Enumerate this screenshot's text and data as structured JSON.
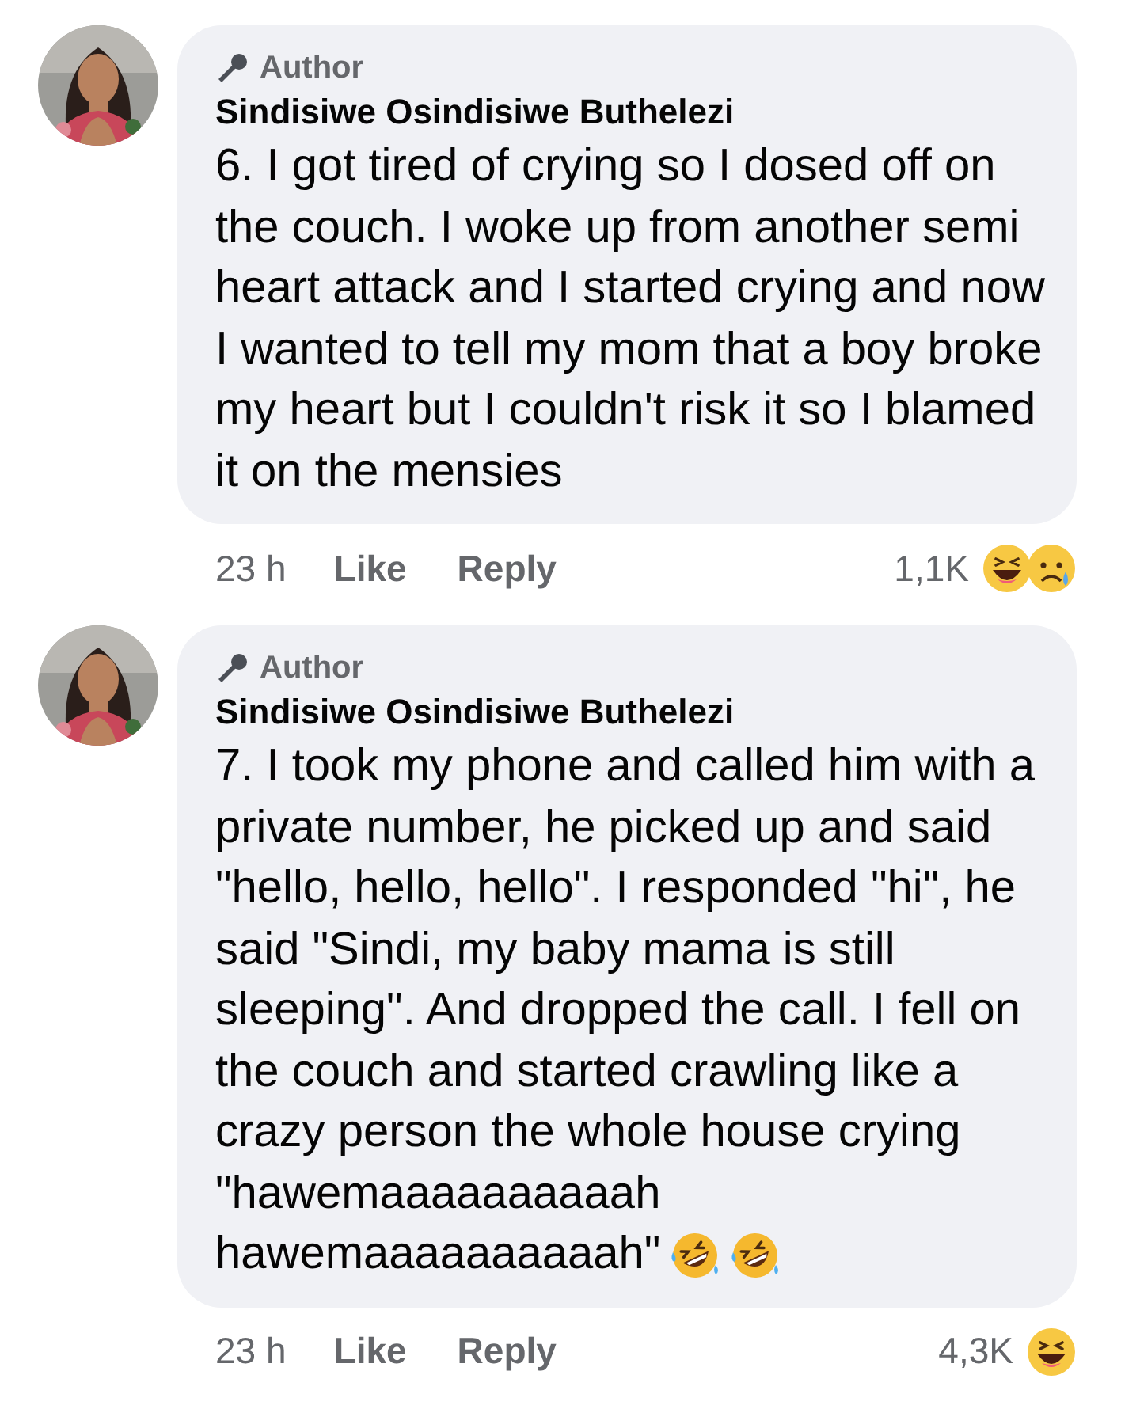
{
  "comments": [
    {
      "badge": "Author",
      "name": "Sindisiwe Osindisiwe Buthelezi",
      "body": "6. I got tired of crying so I dosed off on the couch. I woke up from another semi heart attack and I started crying and now I wanted to tell my mom that a boy broke my heart but I couldn't risk it so I blamed it on the mensies",
      "time": "23 h",
      "actions": [
        "Like",
        "Reply"
      ],
      "reaction_count": "1,1K",
      "reactions": [
        {
          "kind": "laugh"
        },
        {
          "kind": "sad"
        }
      ]
    },
    {
      "badge": "Author",
      "name": "Sindisiwe Osindisiwe Buthelezi",
      "body": "7. I took my phone and called him with a private number, he picked up and said \"hello, hello, hello\". I responded \"hi\", he said \"Sindi, my baby mama is still sleeping\". And dropped the call. I fell on the couch and started crawling like a crazy person the whole house crying \"hawemaaaaaaaaaah hawemaaaaaaaaaah\"",
      "inline_emoji": [
        {
          "kind": "rofl"
        },
        {
          "kind": "rofl"
        }
      ],
      "time": "23 h",
      "actions": [
        "Like",
        "Reply"
      ],
      "reaction_count": "4,3K",
      "reactions": [
        {
          "kind": "laugh"
        }
      ]
    }
  ]
}
